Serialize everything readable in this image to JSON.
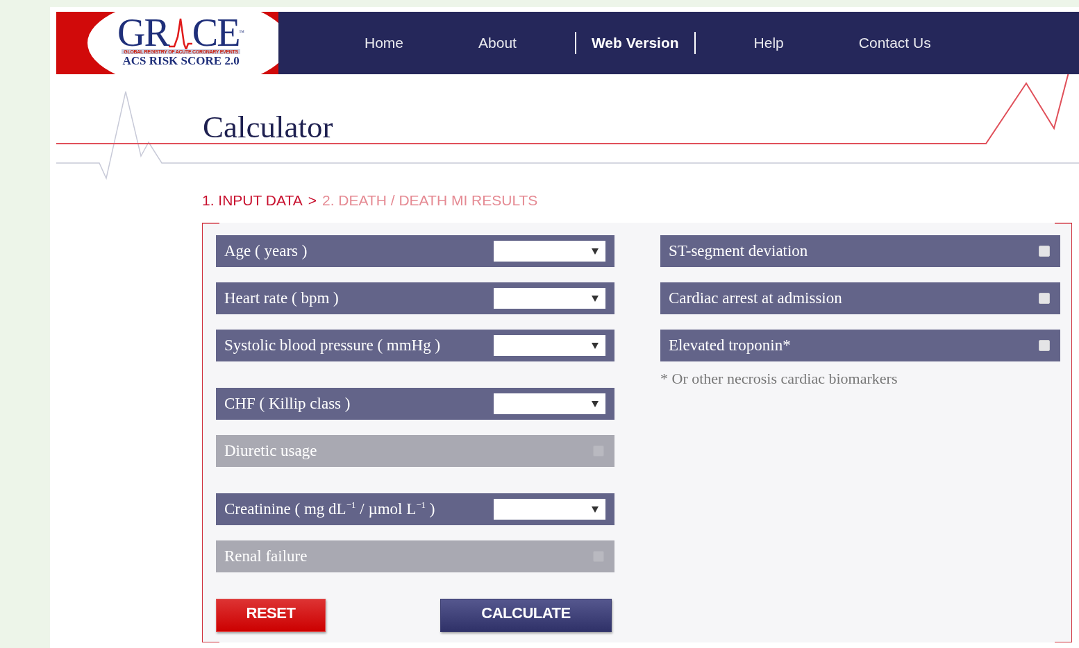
{
  "logo": {
    "left": "GR",
    "right": "CE",
    "tm": "™",
    "tagline": "GLOBAL REGISTRY OF ACUTE CORONARY EVENTS",
    "subtitle": "ACS RISK SCORE 2.0"
  },
  "nav": [
    {
      "label": "Home",
      "selected": false
    },
    {
      "label": "About",
      "selected": false
    },
    {
      "label": "Web Version",
      "selected": true
    },
    {
      "label": "Help",
      "selected": false
    },
    {
      "label": "Contact Us",
      "selected": false
    }
  ],
  "page_title": "Calculator",
  "steps": [
    {
      "label": "1. INPUT DATA",
      "selected": true
    },
    {
      "label": "2. DEATH / DEATH MI RESULTS",
      "selected": false
    }
  ],
  "step_separator": ">",
  "left_groups": [
    [
      {
        "kind": "select",
        "label": "Age ( years )",
        "disabled": false
      },
      {
        "kind": "select",
        "label": "Heart rate ( bpm )",
        "disabled": false
      },
      {
        "kind": "select",
        "label": "Systolic blood pressure ( mmHg )",
        "disabled": false
      }
    ],
    [
      {
        "kind": "select",
        "label": "CHF ( Killip class )",
        "disabled": false
      },
      {
        "kind": "checkbox",
        "label": "Diuretic usage",
        "disabled": true,
        "checked": false
      }
    ],
    [
      {
        "kind": "select",
        "label": "Creatinine ( mg dL$^{−1}$ / µmol L$^{−1}$ )",
        "disabled": false
      },
      {
        "kind": "checkbox",
        "label": "Renal failure",
        "disabled": true,
        "checked": false
      }
    ]
  ],
  "right_rows": [
    {
      "kind": "checkbox",
      "label": "ST-segment deviation",
      "disabled": false,
      "checked": false
    },
    {
      "kind": "checkbox",
      "label": "Cardiac arrest at admission",
      "disabled": false,
      "checked": false
    },
    {
      "kind": "checkbox",
      "label": "Elevated troponin*",
      "disabled": false,
      "checked": false
    }
  ],
  "footnote": "* Or other necrosis cardiac biomarkers",
  "buttons": {
    "reset": "RESET",
    "calculate": "CALCULATE"
  }
}
